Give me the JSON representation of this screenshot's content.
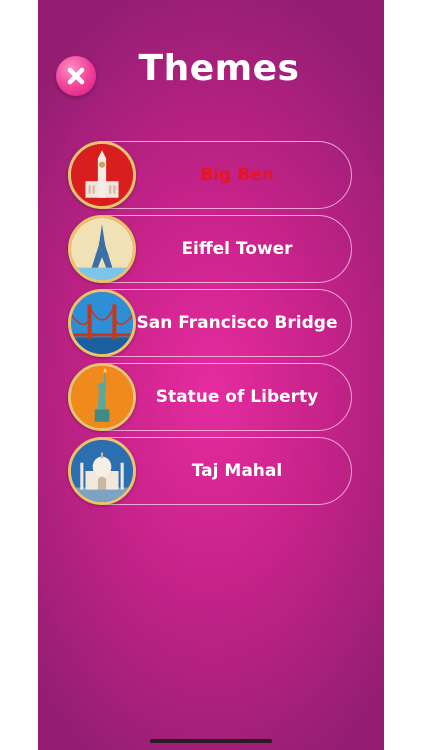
{
  "header": {
    "title": "Themes"
  },
  "themes": [
    {
      "label": "Big Ben",
      "icon": "big-ben-icon",
      "selected": true,
      "bg": "#d81e1e"
    },
    {
      "label": "Eiffel Tower",
      "icon": "eiffel-tower-icon",
      "selected": false,
      "bg": "#f1e2b5"
    },
    {
      "label": "San Francisco Bridge",
      "icon": "golden-gate-bridge-icon",
      "selected": false,
      "bg": "#2f8fd6"
    },
    {
      "label": "Statue of Liberty",
      "icon": "statue-of-liberty-icon",
      "selected": false,
      "bg": "#f08a1d"
    },
    {
      "label": "Taj Mahal",
      "icon": "taj-mahal-icon",
      "selected": false,
      "bg": "#2c6fb0"
    }
  ],
  "colors": {
    "background": "#c8238a",
    "selected_text": "#e8141f",
    "text": "#ffffff",
    "border": "#e8c46a"
  }
}
